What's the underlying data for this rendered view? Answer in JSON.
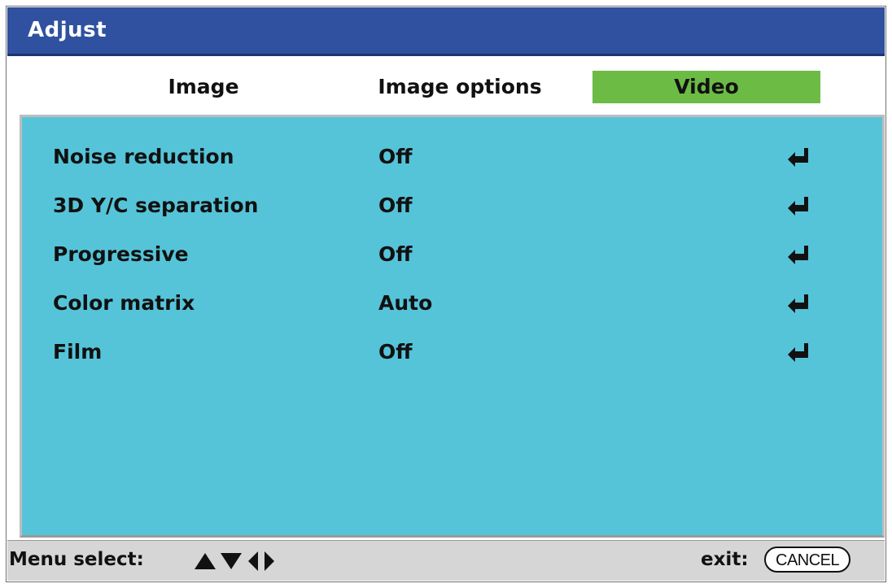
{
  "window": {
    "title": "Adjust"
  },
  "tabs": [
    {
      "label": "Image",
      "selected": false
    },
    {
      "label": "Image options",
      "selected": false
    },
    {
      "label": "Video",
      "selected": true
    }
  ],
  "settings": [
    {
      "label": "Noise reduction",
      "value": "Off"
    },
    {
      "label": "3D Y/C separation",
      "value": "Off"
    },
    {
      "label": "Progressive",
      "value": "Off"
    },
    {
      "label": "Color matrix",
      "value": "Auto"
    },
    {
      "label": "Film",
      "value": "Off"
    }
  ],
  "footer": {
    "menu_select_label": "Menu select:",
    "nav_icons": [
      "up-triangle-icon",
      "down-triangle-icon",
      "left-triangle-icon",
      "right-triangle-icon"
    ],
    "exit_label": "exit:",
    "cancel_key": "CANCEL"
  },
  "colors": {
    "title_bar": "#2f519f",
    "selected_tab": "#6cbb45",
    "panel": "#55c4d9",
    "footer": "#d6d6d6"
  }
}
